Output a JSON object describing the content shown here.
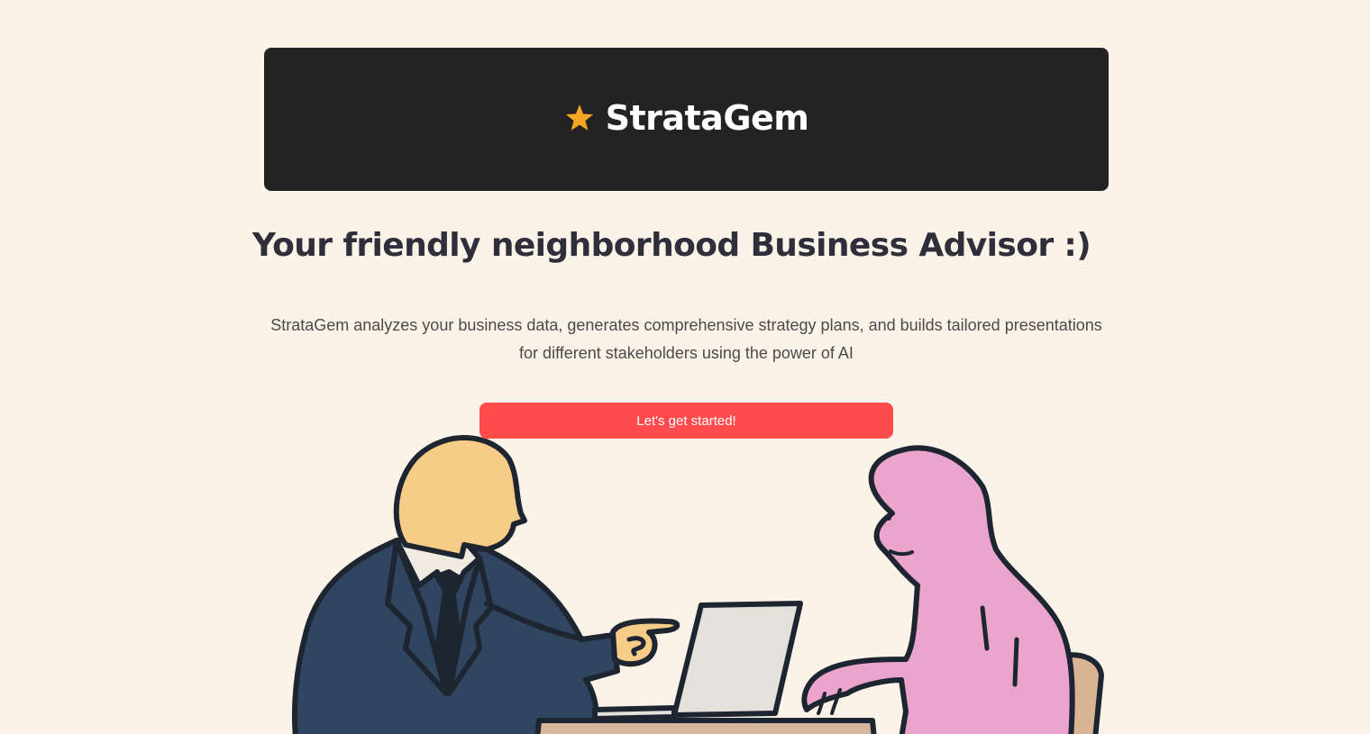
{
  "header": {
    "app_name": "StrataGem",
    "logo_icon": "star-icon",
    "star_color": "#f5a623",
    "background": "#232323"
  },
  "main": {
    "tagline": "Your friendly neighborhood Business Advisor :)",
    "description": "StrataGem analyzes your business data, generates comprehensive strategy plans, and builds tailored presentations for different stakeholders using the power of AI",
    "cta_label": "Let's get started!",
    "cta_color": "#ff4b4b"
  },
  "illustration": {
    "icon": "advisor-meeting-illustration"
  }
}
